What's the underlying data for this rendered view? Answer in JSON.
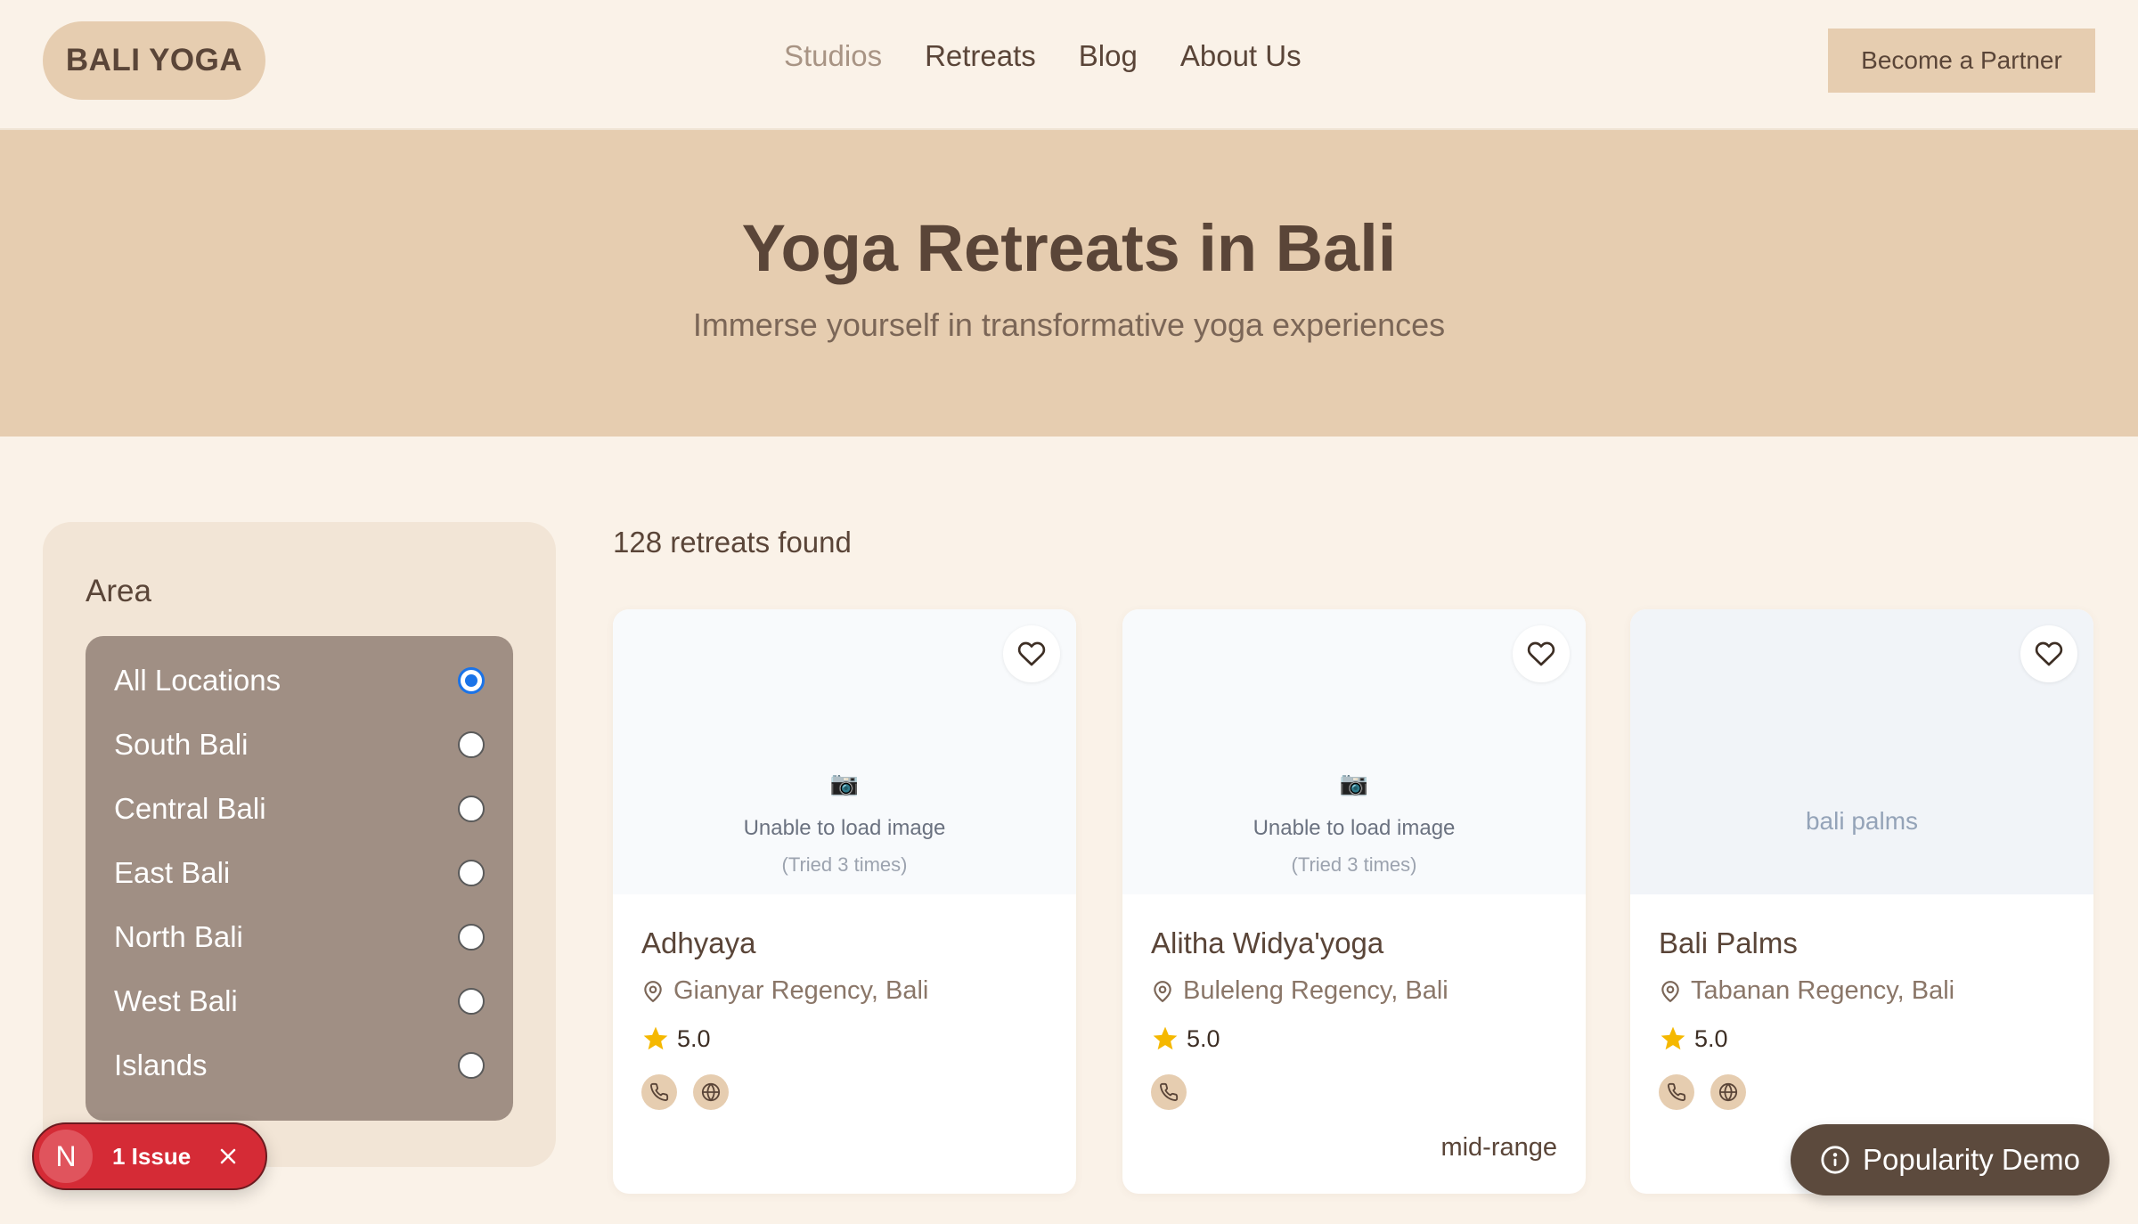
{
  "header": {
    "logo": "BALI YOGA",
    "nav": [
      {
        "label": "Studios",
        "active": true
      },
      {
        "label": "Retreats",
        "active": false
      },
      {
        "label": "Blog",
        "active": false
      },
      {
        "label": "About Us",
        "active": false
      }
    ],
    "partner_button": "Become a Partner"
  },
  "hero": {
    "title": "Yoga Retreats in Bali",
    "subtitle": "Immerse yourself in transformative yoga experiences"
  },
  "filters": {
    "title": "Area",
    "options": [
      {
        "label": "All Locations",
        "selected": true
      },
      {
        "label": "South Bali",
        "selected": false
      },
      {
        "label": "Central Bali",
        "selected": false
      },
      {
        "label": "East Bali",
        "selected": false
      },
      {
        "label": "North Bali",
        "selected": false
      },
      {
        "label": "West Bali",
        "selected": false
      },
      {
        "label": "Islands",
        "selected": false
      }
    ]
  },
  "results": {
    "count_text": "128 retreats found",
    "cards": [
      {
        "name": "Adhyaya",
        "location": "Gianyar Regency, Bali",
        "rating": "5.0",
        "image_error": "Unable to load image",
        "image_retry": "(Tried 3 times)",
        "image_icon": "📷"
      },
      {
        "name": "Alitha Widya'yoga",
        "location": "Buleleng Regency, Bali",
        "rating": "5.0",
        "image_error": "Unable to load image",
        "image_retry": "(Tried 3 times)",
        "image_icon": "📷",
        "price_tier": "mid-range"
      },
      {
        "name": "Bali Palms",
        "location": "Tabanan Regency, Bali",
        "rating": "5.0",
        "image_placeholder": "bali palms"
      }
    ]
  },
  "dev_overlay": {
    "logo_letter": "N",
    "issue_text": "1 Issue"
  },
  "popularity_button": "Popularity Demo",
  "colors": {
    "background": "#faf2e8",
    "accent": "#e6cdb0",
    "text": "#5a4538",
    "filter_panel": "#a08f84",
    "star": "#f5b800",
    "issue_red": "#d52b36"
  }
}
